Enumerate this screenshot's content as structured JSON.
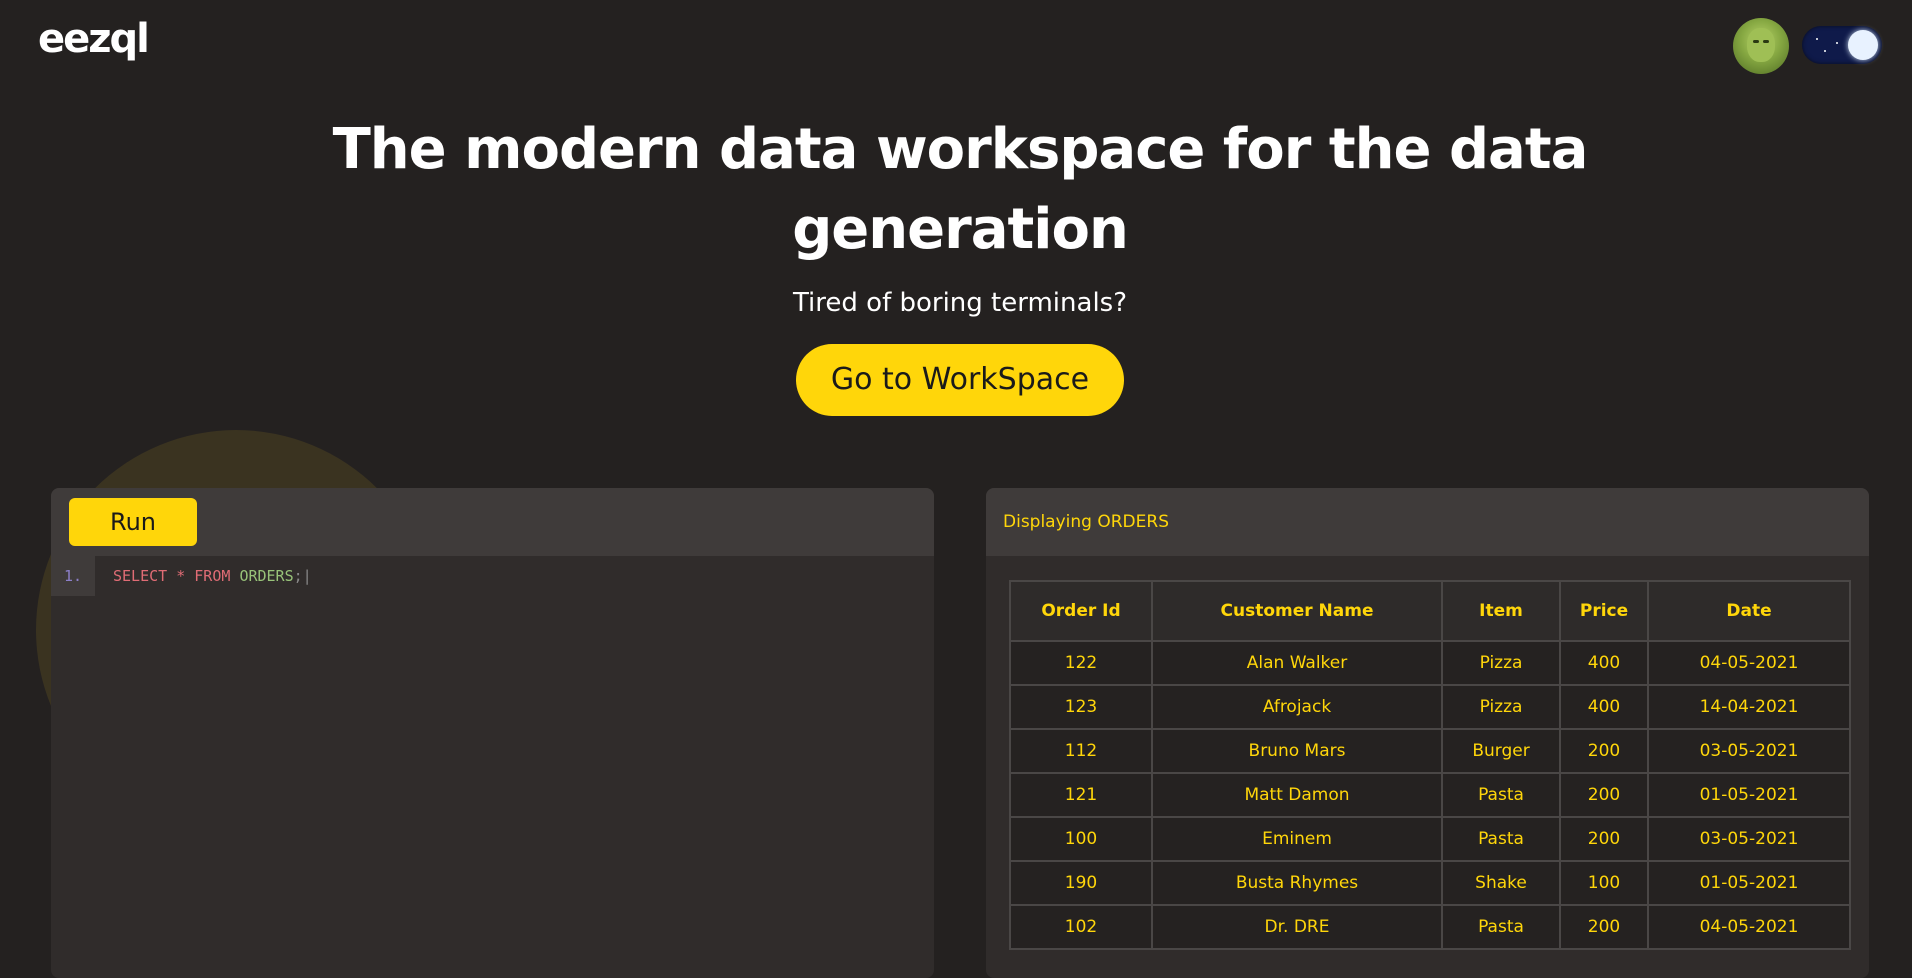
{
  "header": {
    "logo": "eezql",
    "avatar_icon": "user-avatar",
    "theme_toggle_icon": "moon-toggle-icon"
  },
  "hero": {
    "title_line1": "The modern data workspace for the data",
    "title_line2": "generation",
    "subtitle": "Tired of boring terminals?",
    "cta_label": "Go to WorkSpace"
  },
  "editor": {
    "run_label": "Run",
    "line_number": "1.",
    "code": {
      "kw1": "SELECT",
      "star": "*",
      "kw2": "FROM",
      "table": "ORDERS",
      "end": ";|"
    }
  },
  "results": {
    "header": "Displaying ORDERS",
    "columns": [
      "Order Id",
      "Customer Name",
      "Item",
      "Price",
      "Date"
    ],
    "rows": [
      [
        "122",
        "Alan Walker",
        "Pizza",
        "400",
        "04-05-2021"
      ],
      [
        "123",
        "Afrojack",
        "Pizza",
        "400",
        "14-04-2021"
      ],
      [
        "112",
        "Bruno Mars",
        "Burger",
        "200",
        "03-05-2021"
      ],
      [
        "121",
        "Matt Damon",
        "Pasta",
        "200",
        "01-05-2021"
      ],
      [
        "100",
        "Eminem",
        "Pasta",
        "200",
        "03-05-2021"
      ],
      [
        "190",
        "Busta Rhymes",
        "Shake",
        "100",
        "01-05-2021"
      ],
      [
        "102",
        "Dr. DRE",
        "Pasta",
        "200",
        "04-05-2021"
      ]
    ]
  },
  "colors": {
    "background": "#242120",
    "accent": "#ffd60a",
    "panel": "#302c2b"
  }
}
